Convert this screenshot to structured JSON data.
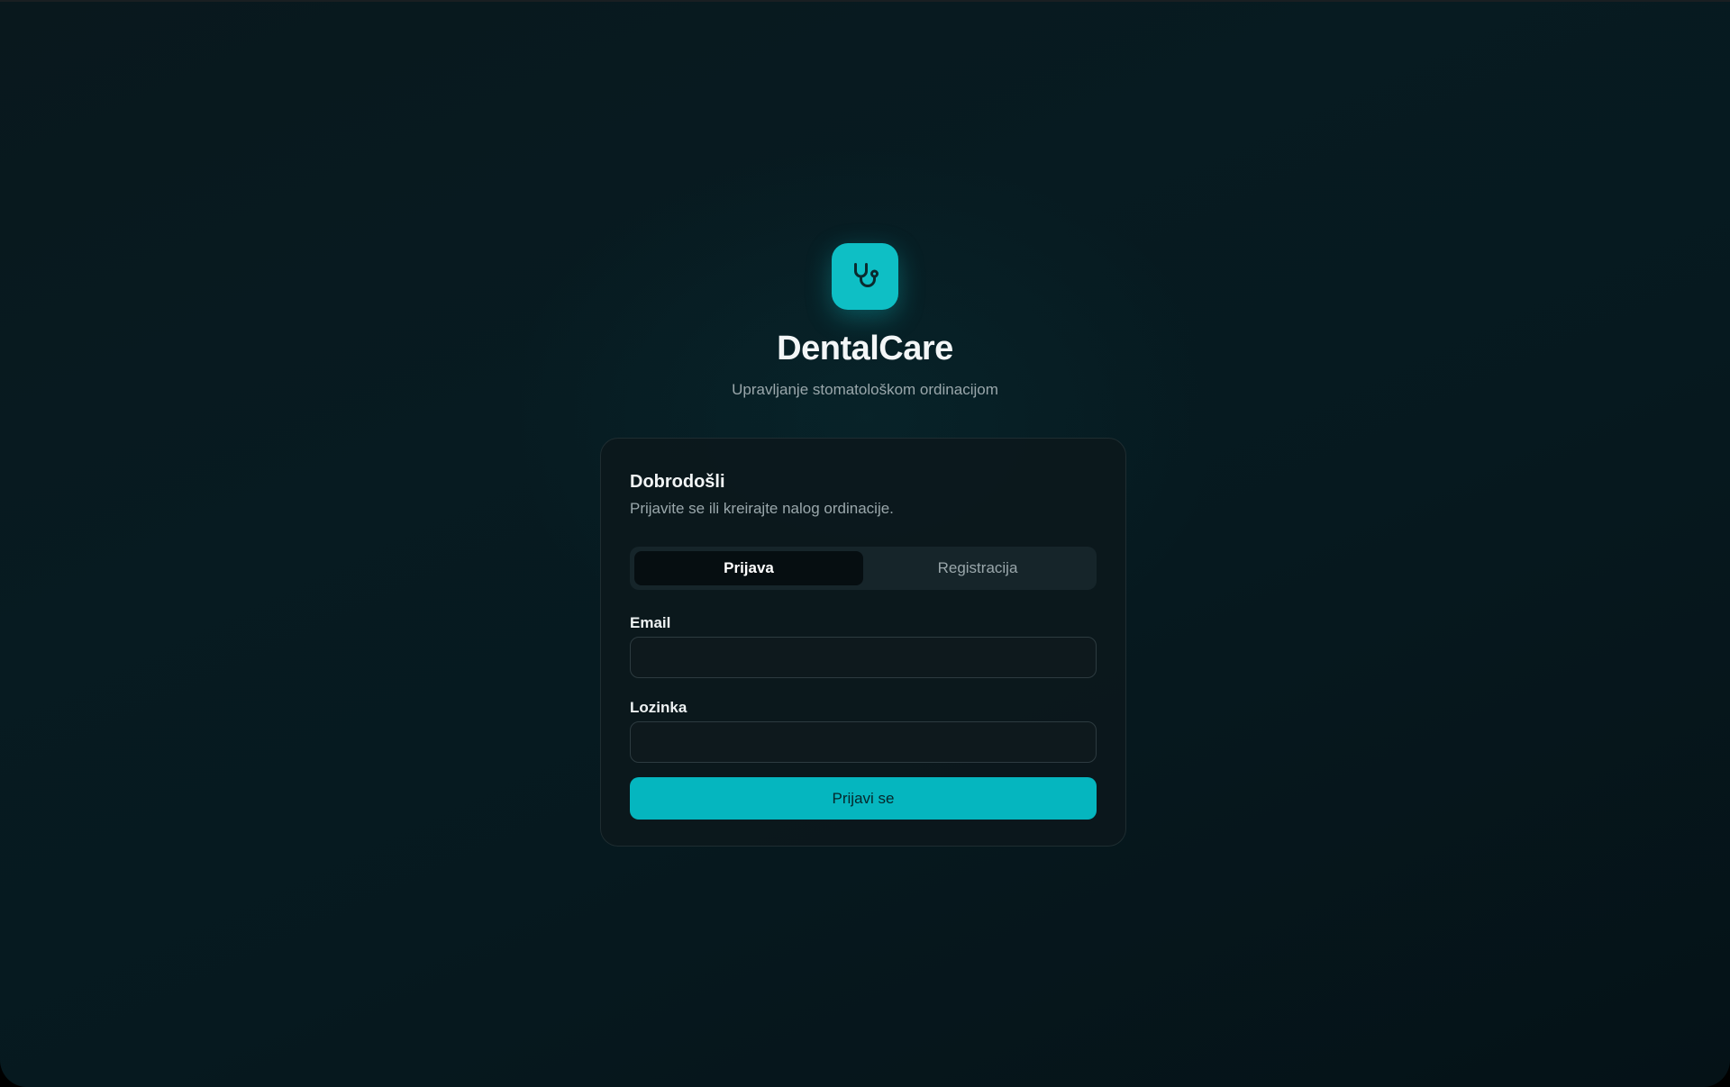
{
  "brand": {
    "logo_icon": "stethoscope-icon",
    "title": "DentalCare",
    "subtitle": "Upravljanje stomatološkom ordinacijom",
    "accent_color": "#0ebfc5"
  },
  "card": {
    "title": "Dobrodošli",
    "description": "Prijavite se ili kreirajte nalog ordinacije.",
    "tabs": [
      {
        "label": "Prijava",
        "active": true
      },
      {
        "label": "Registracija",
        "active": false
      }
    ],
    "email": {
      "label": "Email",
      "value": "",
      "placeholder": ""
    },
    "password": {
      "label": "Lozinka",
      "value": "",
      "placeholder": ""
    },
    "submit_label": "Prijavi se"
  }
}
